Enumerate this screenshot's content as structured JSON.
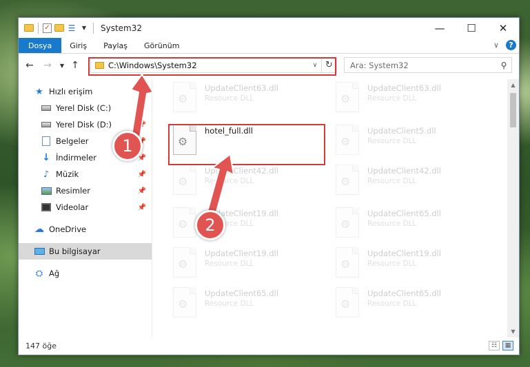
{
  "window": {
    "title": "System32",
    "controls": {
      "minimize": "—",
      "maximize": "☐",
      "close": "✕"
    }
  },
  "ribbon": {
    "tabs": [
      {
        "label": "Dosya",
        "active": true
      },
      {
        "label": "Giriş"
      },
      {
        "label": "Paylaş"
      },
      {
        "label": "Görünüm"
      }
    ],
    "accent": "#1979ca"
  },
  "nav": {
    "address": "C:\\Windows\\System32",
    "search_placeholder": "Ara: System32"
  },
  "sidebar": {
    "items": [
      {
        "label": "Hızlı erişim",
        "icon": "star-icon"
      },
      {
        "label": "Yerel Disk (C:)",
        "icon": "drive-icon",
        "pinned": true
      },
      {
        "label": "Yerel Disk (D:)",
        "icon": "drive-icon",
        "pinned": true
      },
      {
        "label": "Belgeler",
        "icon": "document-icon",
        "pinned": true
      },
      {
        "label": "İndirmeler",
        "icon": "download-icon",
        "pinned": true
      },
      {
        "label": "Müzik",
        "icon": "music-icon",
        "pinned": true
      },
      {
        "label": "Resimler",
        "icon": "picture-icon",
        "pinned": true
      },
      {
        "label": "Videolar",
        "icon": "video-icon",
        "pinned": true
      },
      {
        "label": "OneDrive",
        "icon": "cloud-icon"
      },
      {
        "label": "Bu bilgisayar",
        "icon": "computer-icon",
        "selected": true
      },
      {
        "label": "Ağ",
        "icon": "network-icon"
      }
    ]
  },
  "files": {
    "left": [
      {
        "name": "UpdateClient63.dll",
        "type": "Resource DLL",
        "faded": true
      },
      {
        "name": "hotel_full.dll",
        "type": "",
        "faded": false
      },
      {
        "name": "UpdateClient42.dll",
        "type": "Resource DLL",
        "faded": true
      },
      {
        "name": "UpdateClient19.dll",
        "type": "Resource DLL",
        "faded": true
      },
      {
        "name": "UpdateClient19.dll",
        "type": "Resource DLL",
        "faded": true
      },
      {
        "name": "UpdateClient65.dll",
        "type": "Resource DLL",
        "faded": true
      }
    ],
    "right": [
      {
        "name": "UpdateClient63.dll",
        "type": "Resource DLL",
        "faded": true
      },
      {
        "name": "UpdateClient5.dll",
        "type": "Resource DLL",
        "faded": true
      },
      {
        "name": "UpdateClient42.dll",
        "type": "Resource DLL",
        "faded": true
      },
      {
        "name": "UpdateClient65.dll",
        "type": "Resource DLL",
        "faded": true
      },
      {
        "name": "UpdateClient19.dll",
        "type": "Resource DLL",
        "faded": true
      },
      {
        "name": "UpdateClient65.dll",
        "type": "Resource DLL",
        "faded": true
      }
    ]
  },
  "status": {
    "count": "147 öğe"
  },
  "annotations": {
    "step1": "1",
    "step2": "2",
    "color": "#d23a3a"
  }
}
